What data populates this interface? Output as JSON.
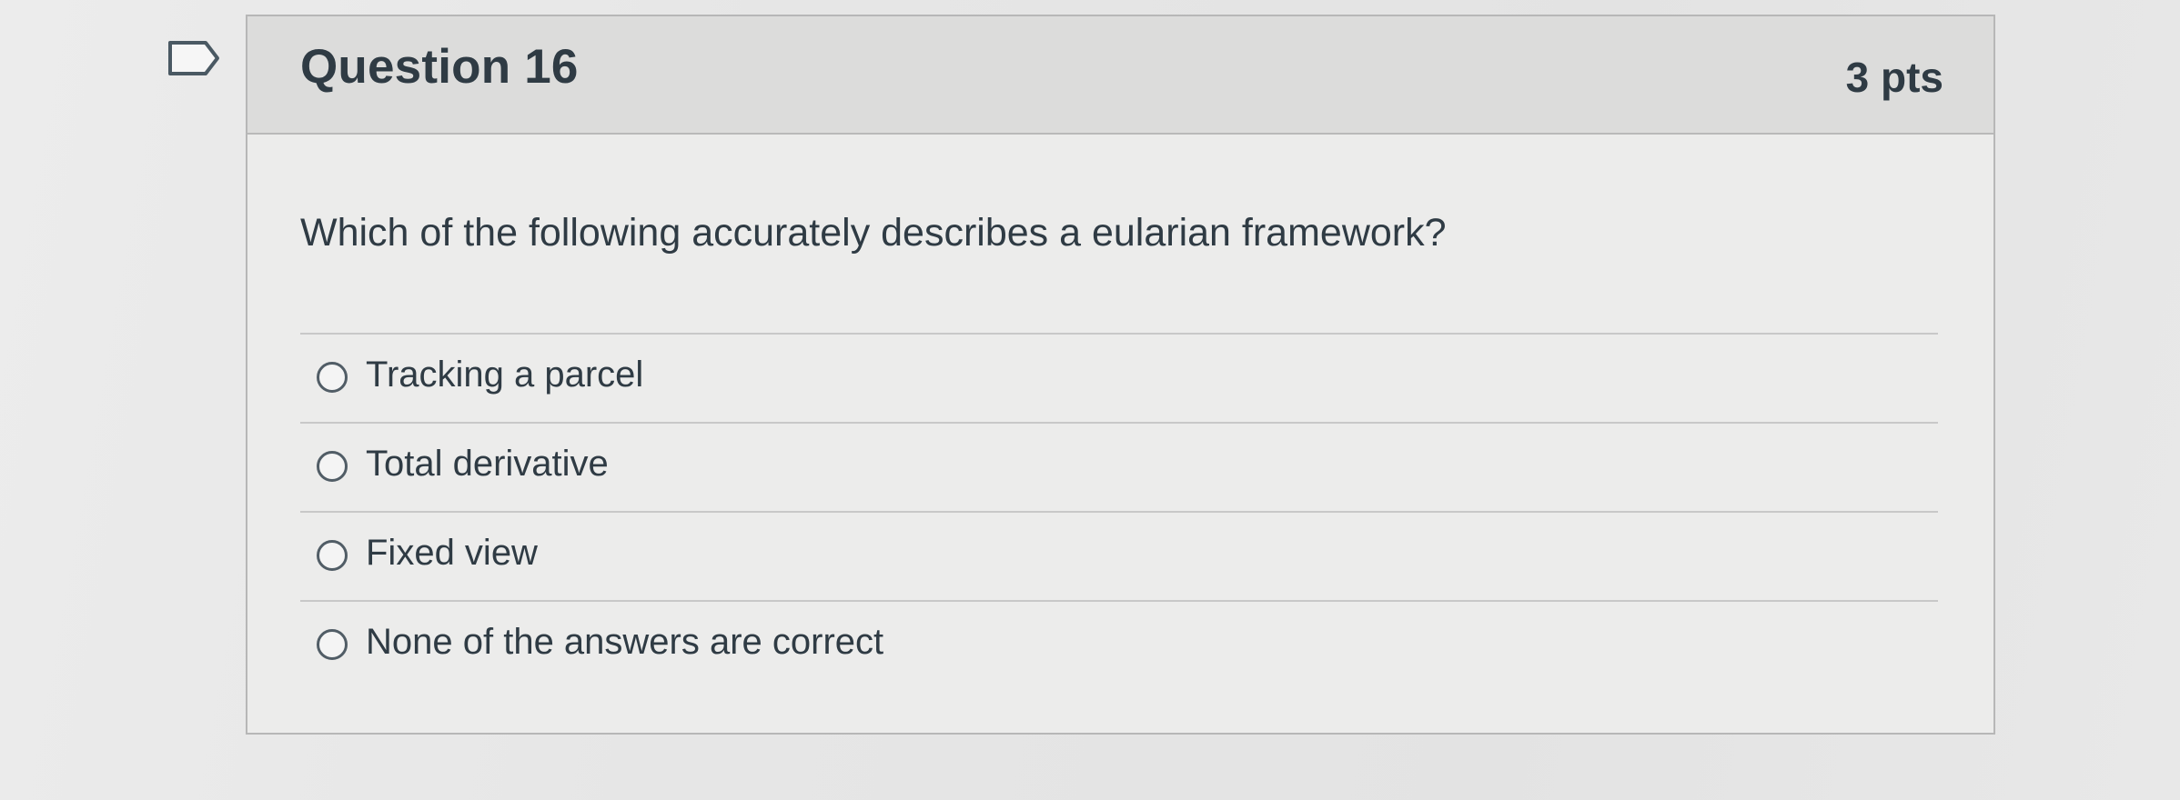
{
  "question": {
    "title": "Question 16",
    "points": "3 pts",
    "text": "Which of the following accurately describes a eularian framework?",
    "answers": [
      "Tracking a parcel",
      "Total derivative",
      "Fixed view",
      "None of the answers are correct"
    ]
  },
  "colors": {
    "header_bg": "#dcdcdb",
    "card_bg": "#ececeb",
    "text": "#2f3b44",
    "border": "#b7b7b7"
  },
  "icons": {
    "flag": "flag-question-icon",
    "radio": "radio-unselected-icon"
  }
}
